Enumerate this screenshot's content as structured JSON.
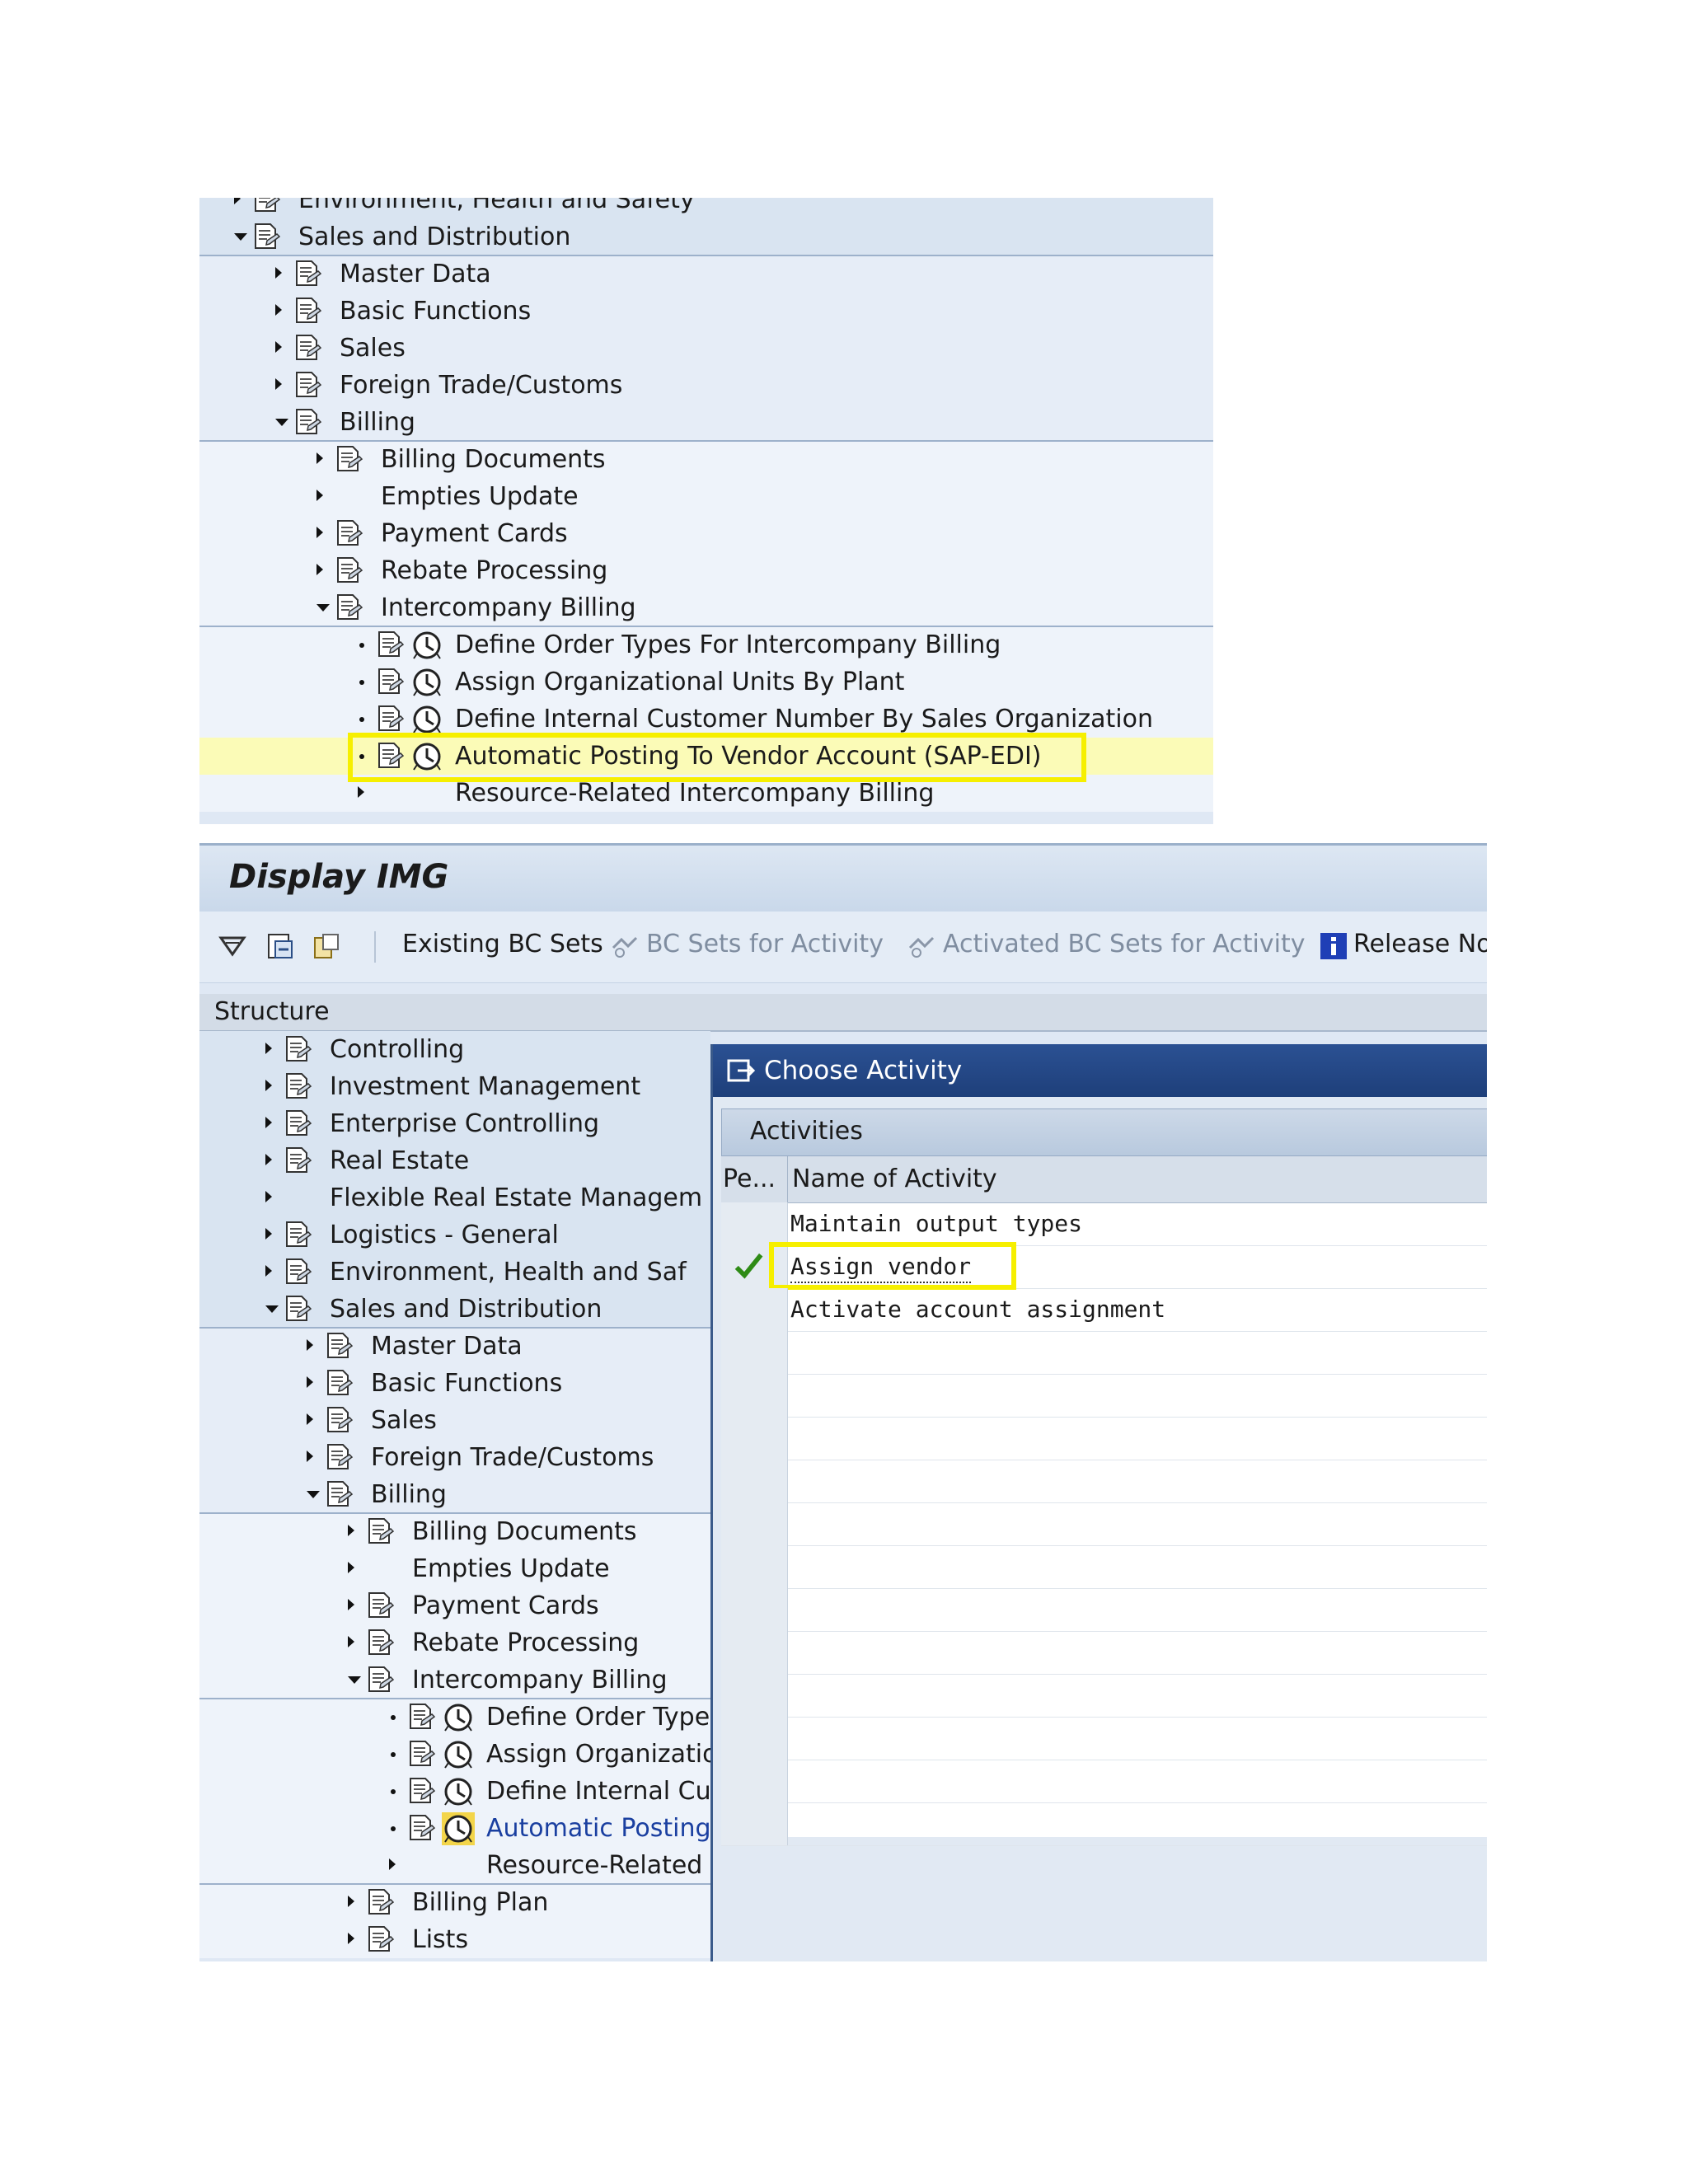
{
  "top_snippet": {
    "rows": [
      {
        "label": "Environment, Health and Safety",
        "arrow": "right",
        "indent": 0,
        "icon": "doc"
      },
      {
        "label": "Sales and Distribution",
        "arrow": "down",
        "indent": 0,
        "icon": "doc"
      },
      {
        "label": "Master Data",
        "arrow": "right",
        "indent": 1,
        "icon": "doc"
      },
      {
        "label": "Basic Functions",
        "arrow": "right",
        "indent": 1,
        "icon": "doc"
      },
      {
        "label": "Sales",
        "arrow": "right",
        "indent": 1,
        "icon": "doc"
      },
      {
        "label": "Foreign Trade/Customs",
        "arrow": "right",
        "indent": 1,
        "icon": "doc"
      },
      {
        "label": "Billing",
        "arrow": "down",
        "indent": 1,
        "icon": "doc"
      },
      {
        "label": "Billing Documents",
        "arrow": "right",
        "indent": 2,
        "icon": "doc"
      },
      {
        "label": "Empties Update",
        "arrow": "right",
        "indent": 2,
        "icon": "none"
      },
      {
        "label": "Payment Cards",
        "arrow": "right",
        "indent": 2,
        "icon": "doc"
      },
      {
        "label": "Rebate Processing",
        "arrow": "right",
        "indent": 2,
        "icon": "doc"
      },
      {
        "label": "Intercompany Billing",
        "arrow": "down",
        "indent": 2,
        "icon": "doc"
      },
      {
        "label": "Define Order Types For Intercompany Billing",
        "arrow": "dot",
        "indent": 3,
        "icon": "doc-clock"
      },
      {
        "label": "Assign Organizational Units By Plant",
        "arrow": "dot",
        "indent": 3,
        "icon": "doc-clock"
      },
      {
        "label": "Define Internal Customer Number By Sales Organization",
        "arrow": "dot",
        "indent": 3,
        "icon": "doc-clock"
      },
      {
        "label": "Automatic Posting To Vendor Account (SAP-EDI)",
        "arrow": "dot",
        "indent": 3,
        "icon": "doc-clock",
        "highlighted": true
      },
      {
        "label": "Resource-Related Intercompany Billing",
        "arrow": "right",
        "indent": 3,
        "icon": "none"
      }
    ]
  },
  "screen": {
    "title": "Display IMG",
    "toolbar": {
      "existing_bc_sets": "Existing BC Sets",
      "bc_sets_for_activity": "BC Sets for Activity",
      "activated_bc_sets": "Activated BC Sets for Activity",
      "release_notes": "Release Not"
    },
    "structure_header": "Structure",
    "tree": [
      {
        "label": "Controlling",
        "arrow": "right",
        "indent": 0,
        "icon": "doc"
      },
      {
        "label": "Investment Management",
        "arrow": "right",
        "indent": 0,
        "icon": "doc"
      },
      {
        "label": "Enterprise Controlling",
        "arrow": "right",
        "indent": 0,
        "icon": "doc"
      },
      {
        "label": "Real Estate",
        "arrow": "right",
        "indent": 0,
        "icon": "doc"
      },
      {
        "label": "Flexible Real Estate Managem",
        "arrow": "right",
        "indent": 0,
        "icon": "none"
      },
      {
        "label": "Logistics - General",
        "arrow": "right",
        "indent": 0,
        "icon": "doc"
      },
      {
        "label": "Environment, Health and Saf",
        "arrow": "right",
        "indent": 0,
        "icon": "doc"
      },
      {
        "label": "Sales and Distribution",
        "arrow": "down",
        "indent": 0,
        "icon": "doc"
      },
      {
        "label": "Master Data",
        "arrow": "right",
        "indent": 1,
        "icon": "doc"
      },
      {
        "label": "Basic Functions",
        "arrow": "right",
        "indent": 1,
        "icon": "doc"
      },
      {
        "label": "Sales",
        "arrow": "right",
        "indent": 1,
        "icon": "doc"
      },
      {
        "label": "Foreign Trade/Customs",
        "arrow": "right",
        "indent": 1,
        "icon": "doc"
      },
      {
        "label": "Billing",
        "arrow": "down",
        "indent": 1,
        "icon": "doc"
      },
      {
        "label": "Billing Documents",
        "arrow": "right",
        "indent": 2,
        "icon": "doc"
      },
      {
        "label": "Empties Update",
        "arrow": "right",
        "indent": 2,
        "icon": "none"
      },
      {
        "label": "Payment Cards",
        "arrow": "right",
        "indent": 2,
        "icon": "doc"
      },
      {
        "label": "Rebate Processing",
        "arrow": "right",
        "indent": 2,
        "icon": "doc"
      },
      {
        "label": "Intercompany Billing",
        "arrow": "down",
        "indent": 2,
        "icon": "doc"
      },
      {
        "label": "Define Order Type",
        "arrow": "dot",
        "indent": 3,
        "icon": "doc-clock"
      },
      {
        "label": "Assign Organizatio",
        "arrow": "dot",
        "indent": 3,
        "icon": "doc-clock"
      },
      {
        "label": "Define Internal Cu",
        "arrow": "dot",
        "indent": 3,
        "icon": "doc-clock"
      },
      {
        "label": "Automatic Posting",
        "arrow": "dot",
        "indent": 3,
        "icon": "doc-clock",
        "selected": true
      },
      {
        "label": "Resource-Related",
        "arrow": "right",
        "indent": 3,
        "icon": "none"
      },
      {
        "label": "Billing Plan",
        "arrow": "right",
        "indent": 2,
        "icon": "doc"
      },
      {
        "label": "Lists",
        "arrow": "right",
        "indent": 2,
        "icon": "doc"
      }
    ],
    "popup": {
      "title": "Choose Activity",
      "tab": "Activities",
      "col_pe": "Pe...",
      "col_name": "Name of Activity",
      "rows": [
        {
          "name": "Maintain output types",
          "done": false
        },
        {
          "name": "Assign vendor",
          "done": true,
          "highlighted": true
        },
        {
          "name": "Activate account assignment",
          "done": false
        }
      ],
      "empty_row_count": 12
    },
    "colors": {
      "highlight_yellow": "#f6ef00",
      "popup_title": "#1e3f7a",
      "selected_text": "#1a3fa0",
      "check_green": "#2e8b16"
    }
  }
}
